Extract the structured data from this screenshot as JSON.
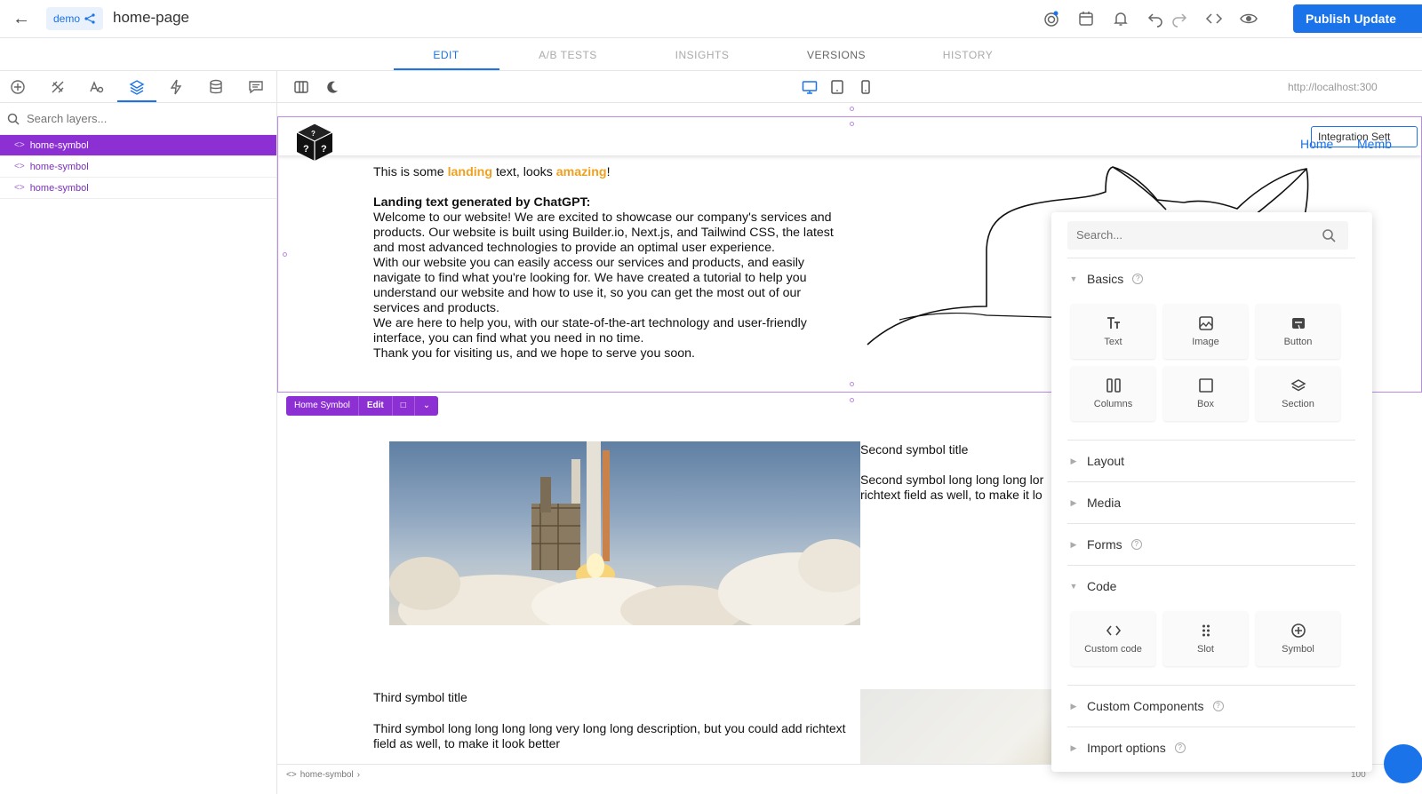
{
  "header": {
    "space_label": "demo",
    "page_name": "home-page",
    "publish_label": "Publish Update"
  },
  "tabs": [
    "EDIT",
    "A/B TESTS",
    "INSIGHTS",
    "VERSIONS",
    "HISTORY"
  ],
  "sidebar": {
    "search_placeholder": "Search layers...",
    "layers": [
      "home-symbol",
      "home-symbol",
      "home-symbol"
    ]
  },
  "canvas": {
    "url": "http://localhost:300",
    "nav": {
      "home": "Home",
      "members": "Memb",
      "integration_button": "Integration Sett"
    },
    "hero": {
      "intro_before": "This is some ",
      "intro_hl1": "landing",
      "intro_mid": " text, looks ",
      "intro_hl2": "amazing",
      "intro_end": "!",
      "gen_title": "Landing text generated by ChatGPT:",
      "p1": "Welcome to our website! We are excited to showcase our company's services and products. Our website is built using Builder.io, Next.js, and Tailwind CSS, the latest and most advanced technologies to provide an optimal user experience.",
      "p2": "With our website you can easily access our services and products, and easily navigate to find what you're looking for. We have created a tutorial to help you understand our website and how to use it, so you can get the most out of our services and products.",
      "p3": "We are here to help you, with our state-of-the-art technology and user-friendly interface, you can find what you need in no time.",
      "p4": "Thank you for visiting us, and we hope to serve you soon."
    },
    "symbol_toolbar": {
      "name": "Home Symbol",
      "edit": "Edit"
    },
    "second": {
      "title": "Second symbol title",
      "desc_line1": "Second symbol long long long lor",
      "desc_line2": "richtext field as well, to make it lo"
    },
    "third": {
      "title": "Third symbol title",
      "desc": "Third symbol long long long long very long long description, but you could add richtext field as well, to make it look better"
    },
    "breadcrumb": "home-symbol",
    "zoom": "100"
  },
  "insert_panel": {
    "search_placeholder": "Search...",
    "basics": {
      "title": "Basics",
      "blocks": [
        "Text",
        "Image",
        "Button",
        "Columns",
        "Box",
        "Section"
      ]
    },
    "sections": [
      "Layout",
      "Media",
      "Forms"
    ],
    "code": {
      "title": "Code",
      "blocks": [
        "Custom code",
        "Slot",
        "Symbol"
      ]
    },
    "custom_components": "Custom Components",
    "import_options": "Import options"
  },
  "colors": {
    "accent": "#1a73e8",
    "symbol_purple": "#8c30d3",
    "highlight": "#f0a020"
  }
}
